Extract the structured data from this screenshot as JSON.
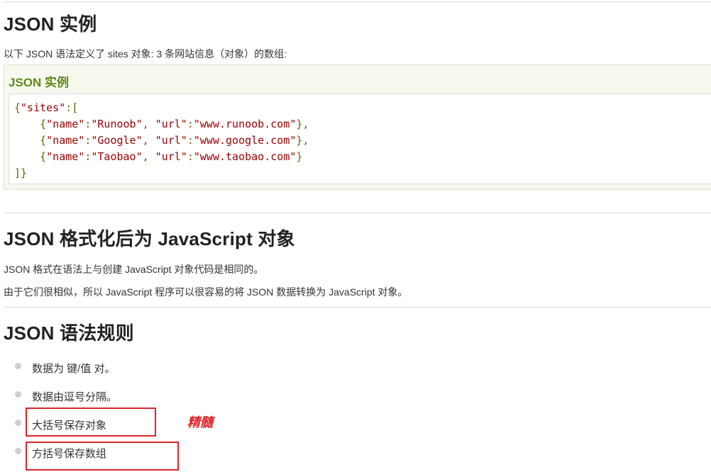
{
  "section1": {
    "title": "JSON 实例",
    "intro": "以下 JSON 语法定义了 sites 对象: 3 条网站信息（对象）的数组:",
    "example_box_title": "JSON 实例",
    "code": {
      "line1_open": "{",
      "line1_key": "\"sites\"",
      "line1_rest": ":[",
      "rows": [
        {
          "name": "\"Runoob\"",
          "url": "\"www.runoob.com\"",
          "end": "},"
        },
        {
          "name": "\"Google\"",
          "url": "\"www.google.com\"",
          "end": "},"
        },
        {
          "name": "\"Taobao\"",
          "url": "\"www.taobao.com\"",
          "end": "}"
        }
      ],
      "key_name": "\"name\"",
      "key_url": "\"url\"",
      "close": "]}"
    }
  },
  "section2": {
    "title": "JSON 格式化后为 JavaScript 对象",
    "p1": "JSON 格式在语法上与创建 JavaScript 对象代码是相同的。",
    "p2": "由于它们很相似，所以 JavaScript 程序可以很容易的将 JSON 数据转换为 JavaScript 对象。"
  },
  "section3": {
    "title": "JSON 语法规则",
    "rules": [
      "数据为 键/值 对。",
      "数据由逗号分隔。",
      "大括号保存对象",
      "方括号保存数组"
    ]
  },
  "annotation": {
    "note": "精髓",
    "color": "#e0262b"
  }
}
